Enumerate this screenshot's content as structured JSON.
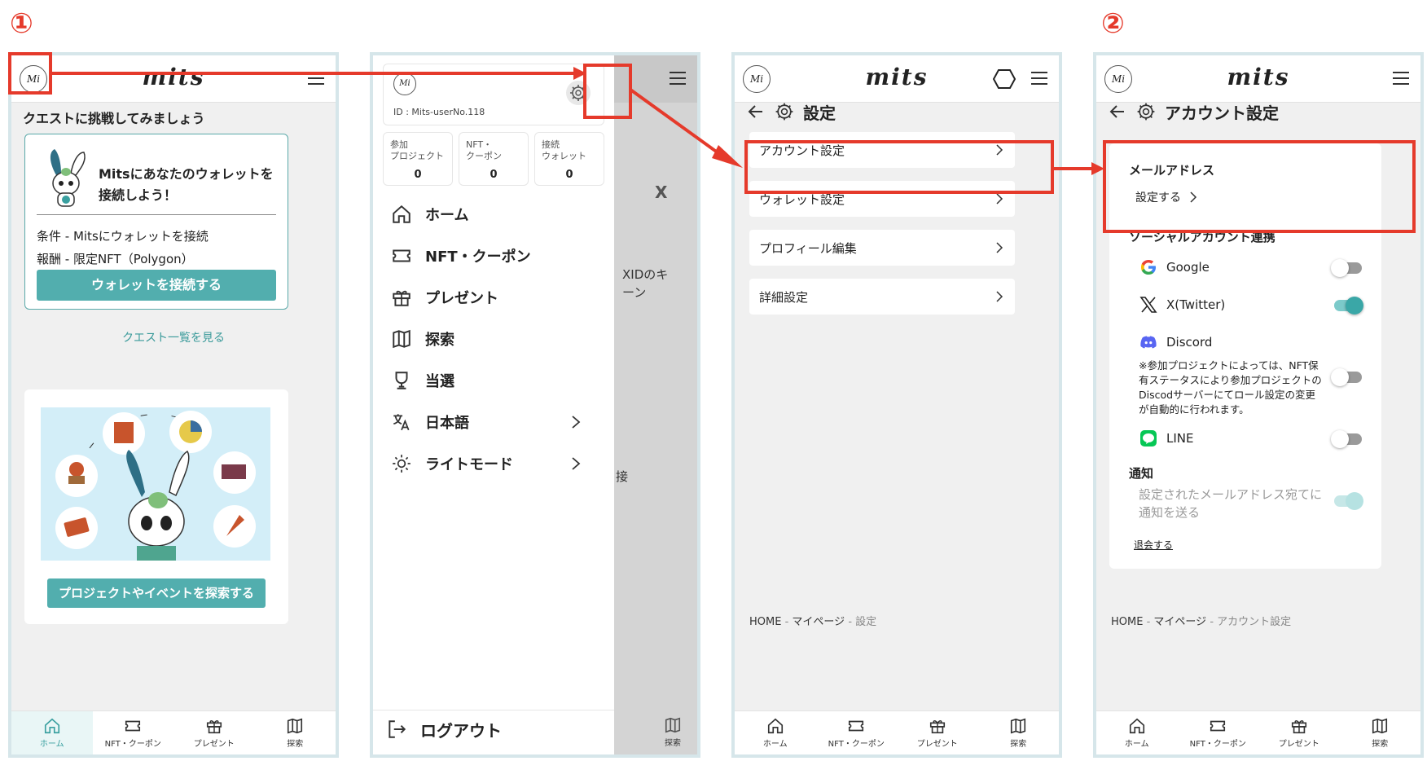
{
  "step_labels": [
    "①",
    "②"
  ],
  "brand_name": "mits",
  "logo_text": "Mi",
  "nav": {
    "home": "ホーム",
    "nft": "NFT・クーポン",
    "present": "プレゼント",
    "explore": "探索"
  },
  "screen_home": {
    "quest_heading": "クエストに挑戦してみましょう",
    "quest_title": "Mitsにあなたのウォレットを接続しよう！",
    "condition": "条件 - Mitsにウォレットを接続",
    "reward": "報酬 - 限定NFT（Polygon）",
    "connect_button": "ウォレットを接続する",
    "quest_list_link": "クエスト一覧を見る",
    "explore_button": "プロジェクトやイベントを探索する"
  },
  "screen_menu": {
    "user_id": "ID : Mits-userNo.118",
    "stats": [
      {
        "label": "参加\nプロジェクト",
        "value": "0"
      },
      {
        "label": "NFT・\nクーポン",
        "value": "0"
      },
      {
        "label": "接続\nウォレット",
        "value": "0"
      }
    ],
    "items": {
      "home": "ホーム",
      "nft": "NFT・クーポン",
      "present": "プレゼント",
      "explore": "探索",
      "winning": "当選",
      "language": "日本語",
      "theme": "ライトモード"
    },
    "logout": "ログアウト",
    "bg_peek_a": "XIDのキ\nーン",
    "bg_peek_b": "接",
    "bg_peek_x": "X"
  },
  "screen_settings": {
    "title": "設定",
    "items": [
      "アカウント設定",
      "ウォレット設定",
      "プロフィール編集",
      "詳細設定"
    ],
    "breadcrumb": {
      "home": "HOME",
      "mypage": "マイページ",
      "current": "設定"
    }
  },
  "screen_account": {
    "title": "アカウント設定",
    "email_label": "メールアドレス",
    "email_action": "設定する",
    "social_label": "ソーシャルアカウント連携",
    "socials": [
      {
        "name": "Google",
        "enabled": false
      },
      {
        "name": "X(Twitter)",
        "enabled": true
      },
      {
        "name": "Discord",
        "enabled": false
      },
      {
        "name": "LINE",
        "enabled": false
      }
    ],
    "discord_note": "※参加プロジェクトによっては、NFT保有ステータスにより参加プロジェクトのDiscodサーバーにてロール設定の変更が自動的に行われます。",
    "notify_label": "通知",
    "notify_text": "設定されたメールアドレス宛てに通知を送る",
    "withdraw": "退会する",
    "breadcrumb": {
      "home": "HOME",
      "mypage": "マイページ",
      "current": "アカウント設定"
    }
  },
  "colors": {
    "accent": "#52aeae",
    "highlight": "#e53a2b",
    "frame": "#d6e6ea"
  }
}
